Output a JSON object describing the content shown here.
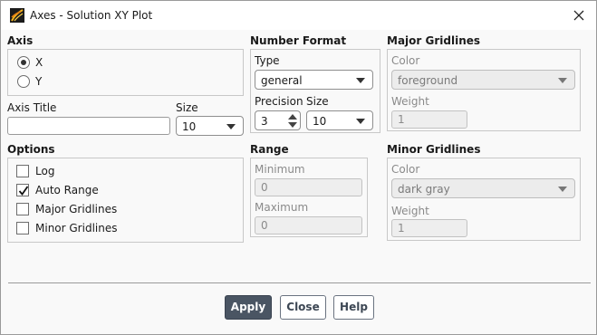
{
  "window": {
    "title": "Axes - Solution XY Plot"
  },
  "axis": {
    "title": "Axis",
    "options": [
      "X",
      "Y"
    ],
    "selected": "X"
  },
  "axis_title": {
    "label": "Axis Title",
    "value": "",
    "size_label": "Size",
    "size_value": "10"
  },
  "options": {
    "title": "Options",
    "items": [
      {
        "label": "Log",
        "checked": false
      },
      {
        "label": "Auto Range",
        "checked": true
      },
      {
        "label": "Major Gridlines",
        "checked": false
      },
      {
        "label": "Minor Gridlines",
        "checked": false
      }
    ]
  },
  "number_format": {
    "title": "Number Format",
    "type_label": "Type",
    "type_value": "general",
    "precision_label": "Precision",
    "precision_value": "3",
    "size_label": "Size",
    "size_value": "10"
  },
  "range": {
    "title": "Range",
    "min_label": "Minimum",
    "min_value": "0",
    "max_label": "Maximum",
    "max_value": "0"
  },
  "major_gridlines": {
    "title": "Major Gridlines",
    "color_label": "Color",
    "color_value": "foreground",
    "weight_label": "Weight",
    "weight_value": "1"
  },
  "minor_gridlines": {
    "title": "Minor Gridlines",
    "color_label": "Color",
    "color_value": "dark gray",
    "weight_label": "Weight",
    "weight_value": "1"
  },
  "buttons": {
    "apply": "Apply",
    "close": "Close",
    "help": "Help"
  },
  "colors": {
    "primary_button": "#4a5563",
    "border": "#c8c8c8"
  },
  "icons": {
    "app": "fluent-app-icon",
    "close": "close-icon",
    "dropdown": "chevron-down-icon"
  }
}
